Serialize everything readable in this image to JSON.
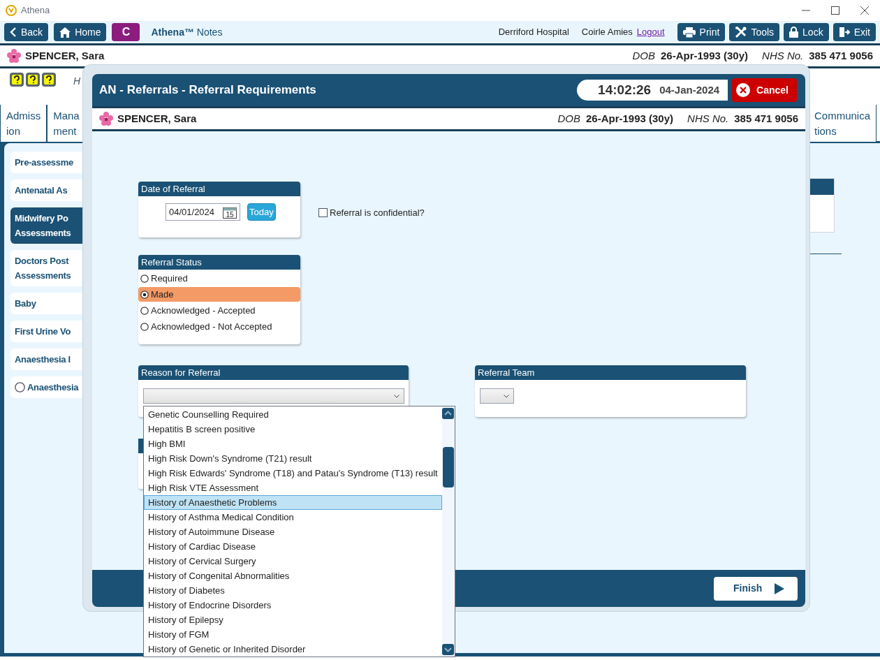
{
  "window": {
    "title": "Athena"
  },
  "toolbar": {
    "left_buttons": [
      {
        "label": "Back",
        "kind": "back"
      },
      {
        "label": "Home",
        "kind": "home"
      }
    ],
    "badge": "C",
    "brand": "**Athena™** Notes",
    "hospital": "Derriford Hospital",
    "user": "Coirle Amies",
    "logout": "Logout",
    "right_buttons": [
      {
        "label": "Print",
        "kind": "print"
      },
      {
        "label": "Tools",
        "kind": "tools"
      },
      {
        "label": "Lock",
        "kind": "lock"
      },
      {
        "label": "Exit",
        "kind": "exit"
      }
    ]
  },
  "patient": {
    "name": "SPENCER, Sara",
    "dob_label": "DOB",
    "dob": "26-Apr-1993 (30y)",
    "nhs_label": "NHS No.",
    "nhs": "385 471 9056"
  },
  "header_fragment": "H",
  "tabs_left": [
    {
      "lines": [
        "Admiss",
        "ion"
      ]
    },
    {
      "lines": [
        "Mana",
        "ment"
      ]
    }
  ],
  "tabs_right": [
    {
      "lines": [
        "Communica",
        "tions"
      ]
    }
  ],
  "sidebar": {
    "items": [
      {
        "lines": [
          "Pre-assessme"
        ],
        "kind": "plain",
        "selected": false
      },
      {
        "lines": [
          "Antenatal As"
        ],
        "kind": "plain",
        "selected": false
      },
      {
        "lines": [
          "Midwifery Po",
          "Assessments"
        ],
        "kind": "plain",
        "selected": true
      },
      {
        "lines": [
          "Doctors Post",
          "Assessments"
        ],
        "kind": "plain",
        "selected": false
      },
      {
        "lines": [
          "Baby"
        ],
        "kind": "plain",
        "selected": false
      },
      {
        "lines": [
          "First Urine Vo"
        ],
        "kind": "plain",
        "selected": false
      },
      {
        "lines": [
          "Anaesthesia I"
        ],
        "kind": "plain",
        "selected": false
      },
      {
        "lines": [
          "Anaesthesia"
        ],
        "kind": "radio",
        "selected": false
      }
    ]
  },
  "modal": {
    "title": "AN - Referrals - Referral Requirements",
    "time": "14:02:26",
    "date": "04-Jan-2024",
    "cancel": "Cancel",
    "patient": {
      "name": "SPENCER, Sara",
      "dob_label": "DOB",
      "dob": "26-Apr-1993 (30y)",
      "nhs_label": "NHS No.",
      "nhs": "385 471 9056"
    },
    "date_of_referral": {
      "label": "Date of Referral",
      "value": "04/01/2024",
      "calendar_day": "15",
      "today": "Today"
    },
    "confidential": {
      "label": "Referral is confidential?",
      "checked": false
    },
    "referral_status": {
      "label": "Referral Status",
      "options": [
        {
          "label": "Required",
          "selected": false
        },
        {
          "label": "Made",
          "selected": true
        },
        {
          "label": "Acknowledged - Accepted",
          "selected": false
        },
        {
          "label": "Acknowledged - Not Accepted",
          "selected": false
        }
      ]
    },
    "reason": {
      "label": "Reason for Referral",
      "dropdown": [
        {
          "label": "Genetic Counselling Required",
          "selected": false
        },
        {
          "label": "Hepatitis B screen positive",
          "selected": false
        },
        {
          "label": "High BMI",
          "selected": false
        },
        {
          "label": "High Risk Down's Syndrome (T21) result",
          "selected": false
        },
        {
          "label": "High Risk Edwards' Syndrome (T18) and Patau's Syndrome (T13) result",
          "selected": false
        },
        {
          "label": "High Risk VTE Assessment",
          "selected": false
        },
        {
          "label": "History of Anaesthetic Problems",
          "selected": true
        },
        {
          "label": "History of Asthma Medical Condition",
          "selected": false
        },
        {
          "label": "History of Autoimmune Disease",
          "selected": false
        },
        {
          "label": "History of Cardiac Disease",
          "selected": false
        },
        {
          "label": "History of Cervical Surgery",
          "selected": false
        },
        {
          "label": "History of Congenital Abnormalities",
          "selected": false
        },
        {
          "label": "History of Diabetes",
          "selected": false
        },
        {
          "label": "History of Endocrine Disorders",
          "selected": false
        },
        {
          "label": "History of Epilepsy",
          "selected": false
        },
        {
          "label": "History of FGM",
          "selected": false
        },
        {
          "label": "History of Genetic or Inherited Disorder",
          "selected": false
        }
      ]
    },
    "referral_team": {
      "label": "Referral Team"
    },
    "finish": "Finish"
  }
}
